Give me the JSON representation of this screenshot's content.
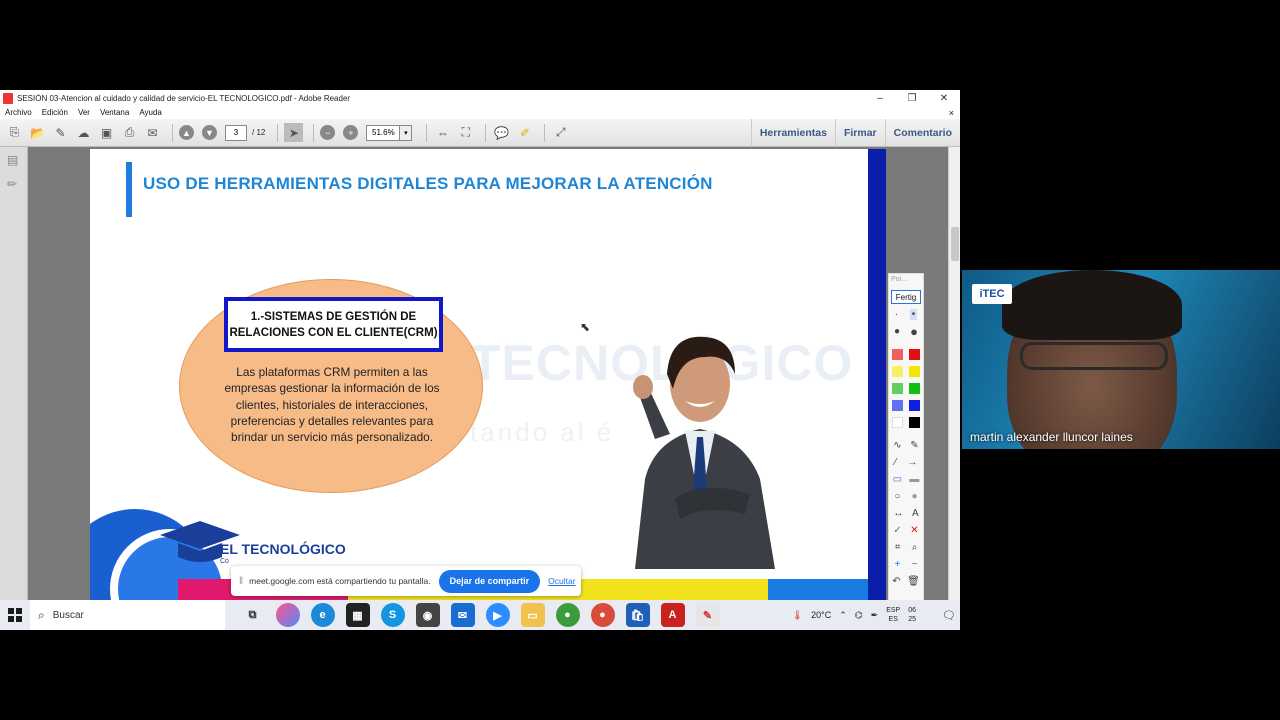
{
  "window": {
    "title": "SESIÓN 03-Atencion al cuidado y calidad de servicio-EL TECNOLOGICO.pdf - Adobe Reader",
    "minimize": "–",
    "restore": "❐",
    "close": "✕"
  },
  "menu": {
    "items": [
      "Archivo",
      "Edición",
      "Ver",
      "Ventana",
      "Ayuda"
    ],
    "close_doc": "×"
  },
  "toolbar": {
    "page_current": "3",
    "page_total": "/ 12",
    "zoom": "51.6%",
    "tabs": [
      "Herramientas",
      "Firmar",
      "Comentario"
    ]
  },
  "slide": {
    "heading": "USO DE HERRAMIENTAS DIGITALES PARA MEJORAR LA ATENCIÓN",
    "crm_title_line1": "1.-SISTEMAS DE GESTIÓN DE",
    "crm_title_line2": "RELACIONES CON EL CLIENTE(CRM)",
    "crm_body": "Las plataformas CRM permiten a las empresas gestionar la información de los clientes, historiales de interacciones, preferencias y detalles relevantes para brindar un servicio más personalizado.",
    "watermark": "TECNOLÓGICO",
    "watermark_sub": "tando al é",
    "logo_text": "EL TECNOLÓGICO",
    "logo_sub": "Co",
    "colors": {
      "heading": "#1f86d6",
      "crm_border": "#1218c8",
      "ellipse": "#f7bb88"
    }
  },
  "palette": {
    "header": "Poi...",
    "done": "Fertig",
    "colors": [
      "#f06060",
      "#e01010",
      "#f7f060",
      "#f0e800",
      "#60d060",
      "#10c010",
      "#6070f0",
      "#1020e0",
      "#ffffff",
      "#000000"
    ]
  },
  "sharebar": {
    "message": "meet.google.com está compartiendo tu pantalla.",
    "stop_label": "Dejar de compartir",
    "hide_label": "Ocultar"
  },
  "taskbar": {
    "search_placeholder": "Buscar",
    "temperature": "20°C",
    "lang_top": "ESP",
    "lang_bottom": "ES",
    "clock_top": "06",
    "clock_bottom": "25"
  },
  "webcam": {
    "participant_name": "martin alexander lluncor laines",
    "logo": "iTEC"
  }
}
